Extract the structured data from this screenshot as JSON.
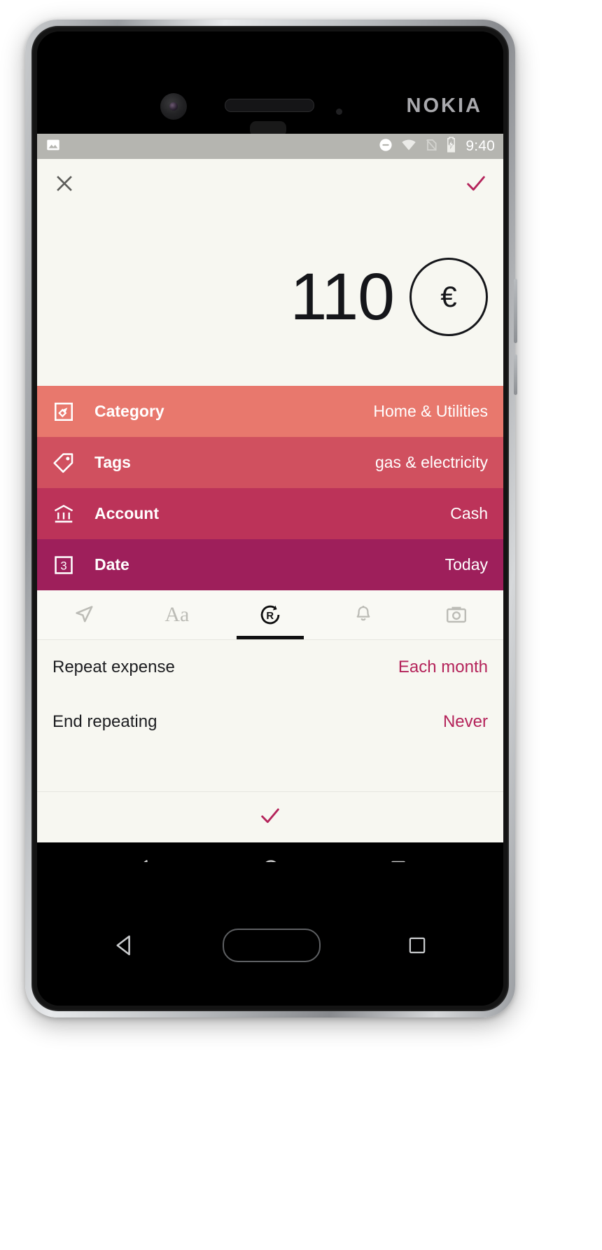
{
  "device": {
    "brand": "NOKIA",
    "front_camera": "front-camera",
    "earpiece": "earpiece-speaker",
    "sensor": "proximity-sensor"
  },
  "statusbar": {
    "time": "9:40",
    "icons": [
      "photo-icon",
      "do-not-disturb-icon",
      "wifi-icon",
      "no-sim-icon",
      "battery-charging-icon"
    ]
  },
  "appbar": {
    "close_label": "close-icon",
    "confirm_label": "check-icon",
    "accent": "#b4235a"
  },
  "amount": {
    "value": "110",
    "currency_symbol": "€"
  },
  "fields": [
    {
      "label": "Category",
      "value": "Home & Utilities",
      "icon": "category-tag-icon",
      "color": "#e8786d"
    },
    {
      "label": "Tags",
      "value": "gas & electricity",
      "icon": "tag-icon",
      "color": "#d0505f"
    },
    {
      "label": "Account",
      "value": "Cash",
      "icon": "bank-icon",
      "color": "#bc3359"
    },
    {
      "label": "Date",
      "value": "Today",
      "icon": "calendar-icon",
      "color": "#9e1f5b"
    }
  ],
  "tabs": [
    {
      "name": "location",
      "icon": "location-arrow-icon",
      "label": "",
      "active": false
    },
    {
      "name": "note",
      "icon": "text-aa-icon",
      "label": "Aa",
      "active": false
    },
    {
      "name": "recurrence",
      "icon": "repeat-r-icon",
      "label": "",
      "active": true
    },
    {
      "name": "reminder",
      "icon": "bell-icon",
      "label": "",
      "active": false
    },
    {
      "name": "photo",
      "icon": "camera-icon",
      "label": "",
      "active": false
    }
  ],
  "details": [
    {
      "label": "Repeat expense",
      "value": "Each month"
    },
    {
      "label": "End repeating",
      "value": "Never"
    }
  ],
  "confirm": {
    "icon": "check-icon",
    "color": "#b4235a"
  },
  "navbar": {
    "back": "back-triangle-icon",
    "home": "home-circle-icon",
    "recents": "recents-square-icon"
  },
  "hardware_keys": {
    "back": "hw-back-icon",
    "home": "hw-home-key",
    "recents": "hw-recents-icon"
  },
  "colors": {
    "screen_bg": "#f7f7f1",
    "accent": "#b4235a",
    "statusbar_bg": "#b5b5b0"
  }
}
